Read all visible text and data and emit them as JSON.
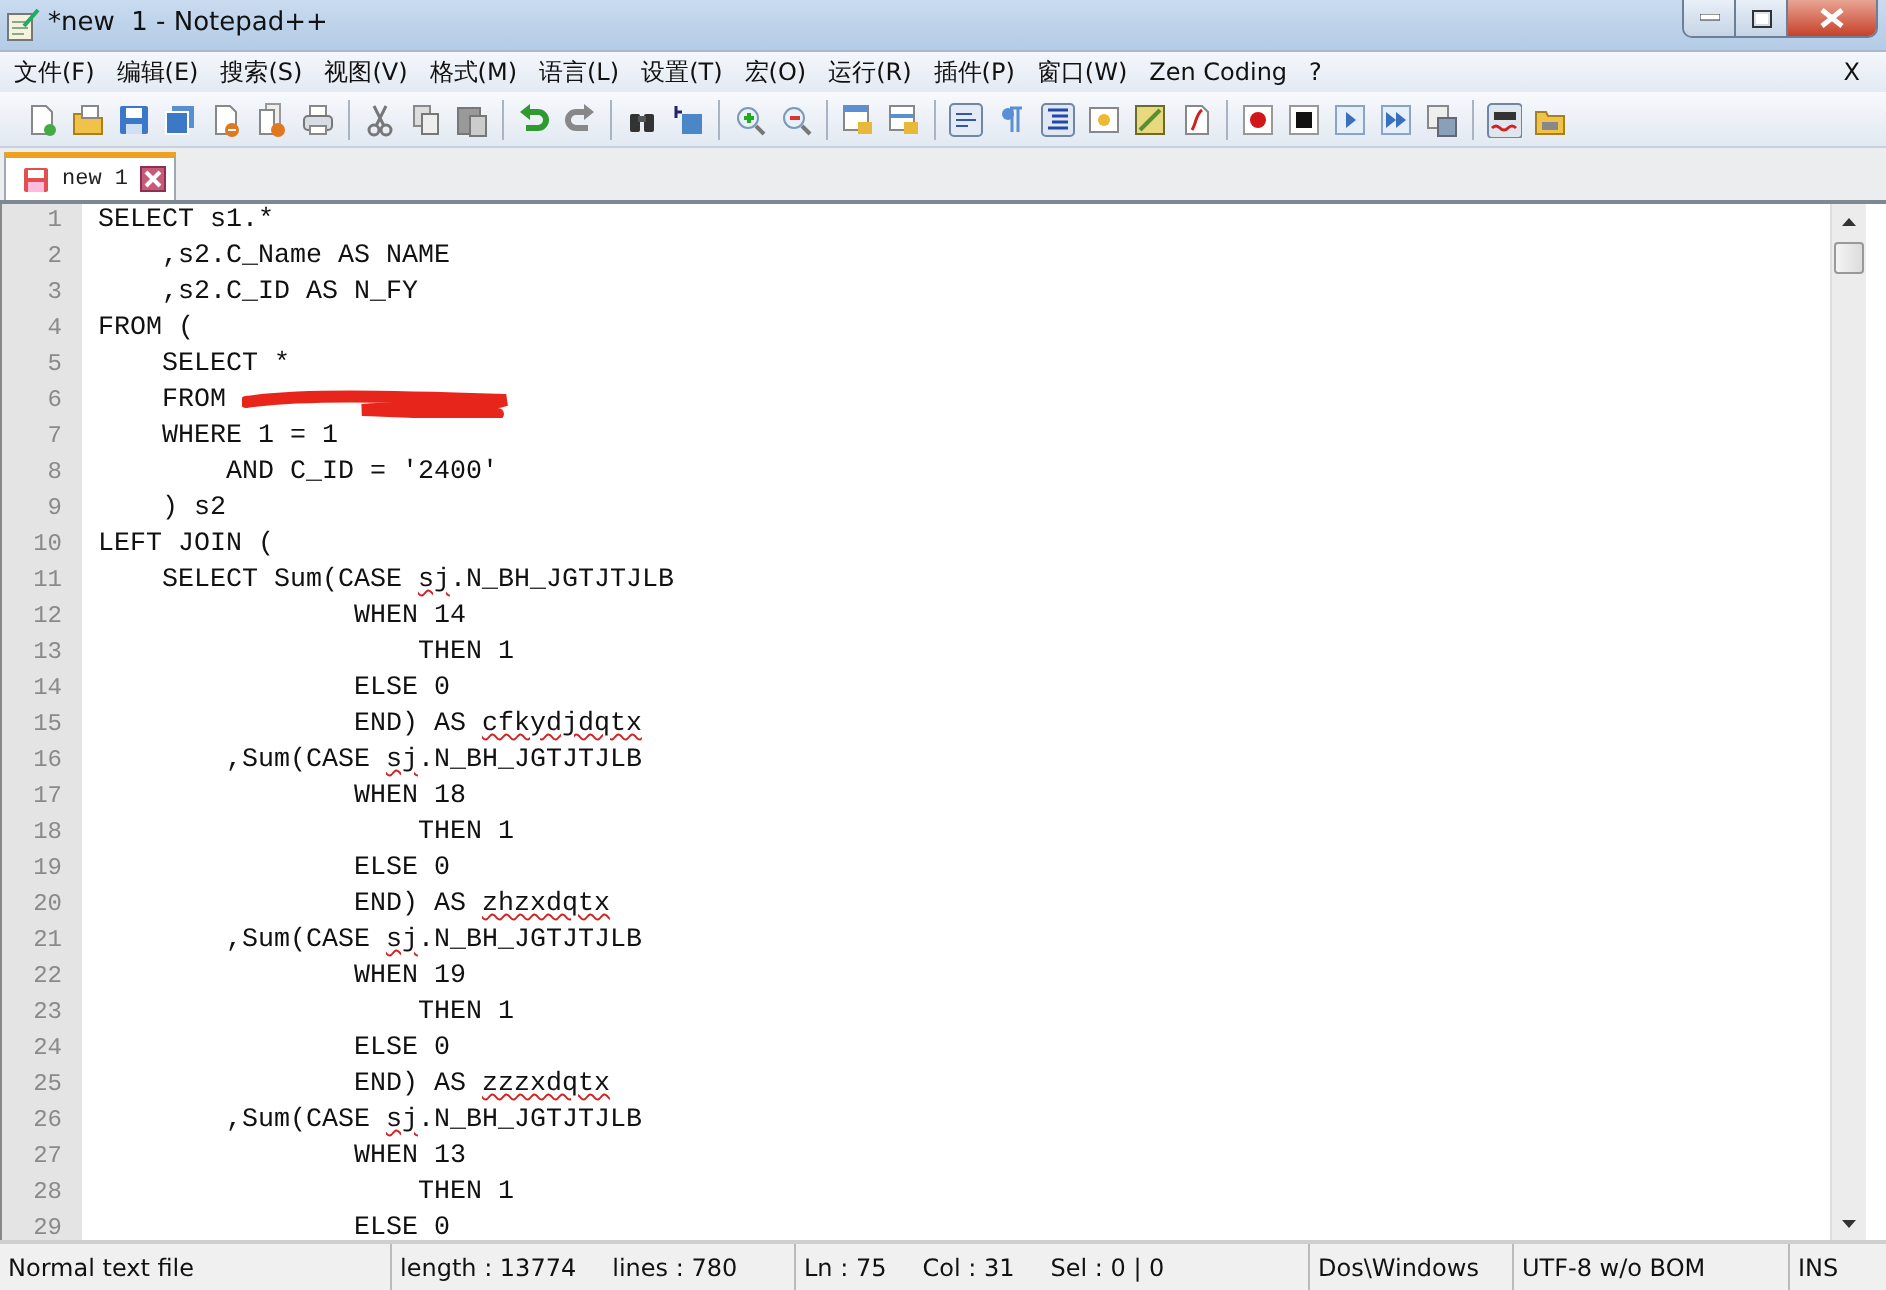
{
  "window": {
    "title": "*new  1 - Notepad++",
    "close_label": "X"
  },
  "menu": [
    "文件(F)",
    "编辑(E)",
    "搜索(S)",
    "视图(V)",
    "格式(M)",
    "语言(L)",
    "设置(T)",
    "宏(O)",
    "运行(R)",
    "插件(P)",
    "窗口(W)",
    "Zen Coding",
    "?"
  ],
  "tabs": [
    {
      "label": "new 1",
      "selected": true,
      "modified": true
    }
  ],
  "editor": {
    "lines": [
      {
        "number": "1",
        "segments": [
          {
            "text": "SELECT s1.*",
            "misspelled": false
          }
        ]
      },
      {
        "number": "2",
        "segments": [
          {
            "text": "    ,s2.C_Name AS NAME",
            "misspelled": false
          }
        ]
      },
      {
        "number": "3",
        "segments": [
          {
            "text": "    ,s2.C_ID AS N_FY",
            "misspelled": false
          }
        ]
      },
      {
        "number": "4",
        "segments": [
          {
            "text": "FROM (",
            "misspelled": false
          }
        ]
      },
      {
        "number": "5",
        "segments": [
          {
            "text": "    SELECT *",
            "misspelled": false
          }
        ]
      },
      {
        "number": "6",
        "segments": [
          {
            "text": "    FROM ",
            "misspelled": false
          }
        ],
        "redacted": true
      },
      {
        "number": "7",
        "segments": [
          {
            "text": "    WHERE 1 = 1",
            "misspelled": false
          }
        ]
      },
      {
        "number": "8",
        "segments": [
          {
            "text": "        AND C_ID = '2400'",
            "misspelled": false
          }
        ]
      },
      {
        "number": "9",
        "segments": [
          {
            "text": "    ) s2",
            "misspelled": false
          }
        ]
      },
      {
        "number": "10",
        "segments": [
          {
            "text": "LEFT JOIN (",
            "misspelled": false
          }
        ]
      },
      {
        "number": "11",
        "segments": [
          {
            "text": "    SELECT Sum(CASE ",
            "misspelled": false
          },
          {
            "text": "sj",
            "misspelled": true
          },
          {
            "text": ".N_BH_JGTJTJLB",
            "misspelled": false
          }
        ]
      },
      {
        "number": "12",
        "segments": [
          {
            "text": "                WHEN 14",
            "misspelled": false
          }
        ]
      },
      {
        "number": "13",
        "segments": [
          {
            "text": "                    THEN 1",
            "misspelled": false
          }
        ]
      },
      {
        "number": "14",
        "segments": [
          {
            "text": "                ELSE 0",
            "misspelled": false
          }
        ]
      },
      {
        "number": "15",
        "segments": [
          {
            "text": "                END) AS ",
            "misspelled": false
          },
          {
            "text": "cfkydjdqtx",
            "misspelled": true
          }
        ]
      },
      {
        "number": "16",
        "segments": [
          {
            "text": "        ,Sum(CASE ",
            "misspelled": false
          },
          {
            "text": "sj",
            "misspelled": true
          },
          {
            "text": ".N_BH_JGTJTJLB",
            "misspelled": false
          }
        ]
      },
      {
        "number": "17",
        "segments": [
          {
            "text": "                WHEN 18",
            "misspelled": false
          }
        ]
      },
      {
        "number": "18",
        "segments": [
          {
            "text": "                    THEN 1",
            "misspelled": false
          }
        ]
      },
      {
        "number": "19",
        "segments": [
          {
            "text": "                ELSE 0",
            "misspelled": false
          }
        ]
      },
      {
        "number": "20",
        "segments": [
          {
            "text": "                END) AS ",
            "misspelled": false
          },
          {
            "text": "zhzxdqtx",
            "misspelled": true
          }
        ]
      },
      {
        "number": "21",
        "segments": [
          {
            "text": "        ,Sum(CASE ",
            "misspelled": false
          },
          {
            "text": "sj",
            "misspelled": true
          },
          {
            "text": ".N_BH_JGTJTJLB",
            "misspelled": false
          }
        ]
      },
      {
        "number": "22",
        "segments": [
          {
            "text": "                WHEN 19",
            "misspelled": false
          }
        ]
      },
      {
        "number": "23",
        "segments": [
          {
            "text": "                    THEN 1",
            "misspelled": false
          }
        ]
      },
      {
        "number": "24",
        "segments": [
          {
            "text": "                ELSE 0",
            "misspelled": false
          }
        ]
      },
      {
        "number": "25",
        "segments": [
          {
            "text": "                END) AS ",
            "misspelled": false
          },
          {
            "text": "zzzxdqtx",
            "misspelled": true
          }
        ]
      },
      {
        "number": "26",
        "segments": [
          {
            "text": "        ,Sum(CASE ",
            "misspelled": false
          },
          {
            "text": "sj",
            "misspelled": true
          },
          {
            "text": ".N_BH_JGTJTJLB",
            "misspelled": false
          }
        ]
      },
      {
        "number": "27",
        "segments": [
          {
            "text": "                WHEN 13",
            "misspelled": false
          }
        ]
      },
      {
        "number": "28",
        "segments": [
          {
            "text": "                    THEN 1",
            "misspelled": false
          }
        ]
      },
      {
        "number": "29",
        "segments": [
          {
            "text": "                ELSE 0",
            "misspelled": false
          }
        ]
      }
    ]
  },
  "status_bar": {
    "file_type": "Normal text file",
    "length": "length : 13774",
    "lines": "lines : 780",
    "line": "Ln : 75",
    "column": "Col : 31",
    "selection": "Sel : 0 | 0",
    "line_endings": "Dos\\Windows",
    "encoding": "UTF-8 w/o BOM",
    "mode": "INS"
  }
}
